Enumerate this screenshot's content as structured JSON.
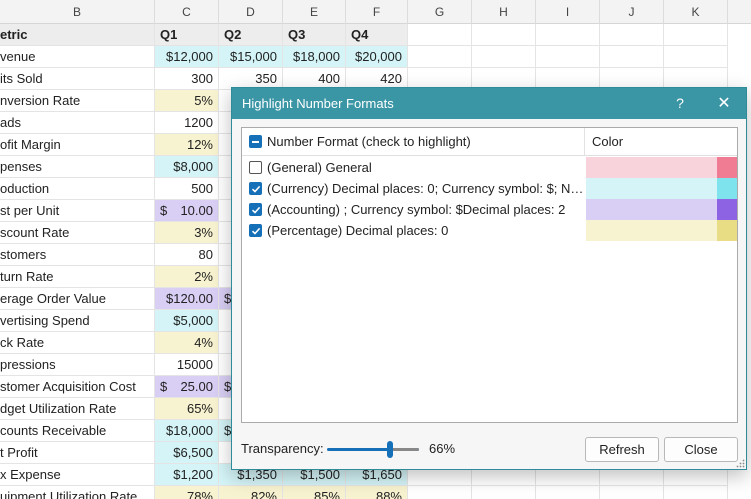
{
  "sheet": {
    "columns": [
      "B",
      "C",
      "D",
      "E",
      "F",
      "G",
      "H",
      "I",
      "J",
      "K"
    ],
    "header_row": [
      "etric",
      "Q1",
      "Q2",
      "Q3",
      "Q4"
    ],
    "rows": [
      {
        "label": "venue",
        "c": "$12,000",
        "d": "$15,000",
        "e": "$18,000",
        "f": "$20,000"
      },
      {
        "label": "its Sold",
        "c": "300",
        "d": "350",
        "e": "400",
        "f": "420"
      },
      {
        "label": "nversion Rate",
        "c": "5%"
      },
      {
        "label": "ads",
        "c": "1200"
      },
      {
        "label": "ofit Margin",
        "c": "12%"
      },
      {
        "label": "penses",
        "c": "$8,000"
      },
      {
        "label": "oduction",
        "c": "500"
      },
      {
        "label": "st per Unit",
        "c_sym": "$",
        "c_num": "10.00"
      },
      {
        "label": "scount Rate",
        "c": "3%"
      },
      {
        "label": "stomers",
        "c": "80"
      },
      {
        "label": "turn Rate",
        "c": "2%"
      },
      {
        "label": "erage Order Value",
        "c": "$120.00",
        "d_partial": "$"
      },
      {
        "label": "vertising Spend",
        "c": "$5,000"
      },
      {
        "label": "ck Rate",
        "c": "4%"
      },
      {
        "label": "pressions",
        "c": "15000"
      },
      {
        "label": "stomer Acquisition Cost",
        "c_sym": "$",
        "c_num": "25.00",
        "d_partial": "$"
      },
      {
        "label": "dget Utilization Rate",
        "c": "65%"
      },
      {
        "label": "counts Receivable",
        "c": "$18,000",
        "d_partial": "$"
      },
      {
        "label": "t Profit",
        "c": "$6,500"
      },
      {
        "label": "x Expense",
        "c": "$1,200",
        "d": "$1,350",
        "e": "$1,500",
        "f": "$1,650"
      },
      {
        "label": "uipment Utilization Rate",
        "c": "78%",
        "d": "82%",
        "e": "85%",
        "f": "88%"
      }
    ]
  },
  "dialog": {
    "title": "Highlight Number Formats",
    "help": "?",
    "close_x": "✕",
    "list_header": {
      "format_col": "Number Format (check to highlight)",
      "color_col": "Color"
    },
    "formats": [
      {
        "label": "(General) General",
        "checked": false,
        "swatch": "#f9d3dc",
        "strong": "#ef7c92"
      },
      {
        "label": "(Currency) Decimal places: 0; Currency symbol: $; Ne...",
        "checked": true,
        "swatch": "#d4f4f7",
        "strong": "#7fe3ee"
      },
      {
        "label": "(Accounting) ; Currency symbol: $Decimal places: 2",
        "checked": true,
        "swatch": "#d9cff5",
        "strong": "#8d62e3"
      },
      {
        "label": "(Percentage) Decimal places: 0",
        "checked": true,
        "swatch": "#f7f2cf",
        "strong": "#e8dc84"
      }
    ],
    "transparency_label": "Transparency:",
    "transparency_value": "66%",
    "refresh_label": "Refresh",
    "close_label": "Close"
  },
  "colors": {
    "titlebar": "#3a95a5",
    "checkbox": "#1670b8",
    "currency_fill": "#d4f4f7",
    "accounting_fill": "#d9cff5",
    "percentage_fill": "#f7f2cf"
  }
}
